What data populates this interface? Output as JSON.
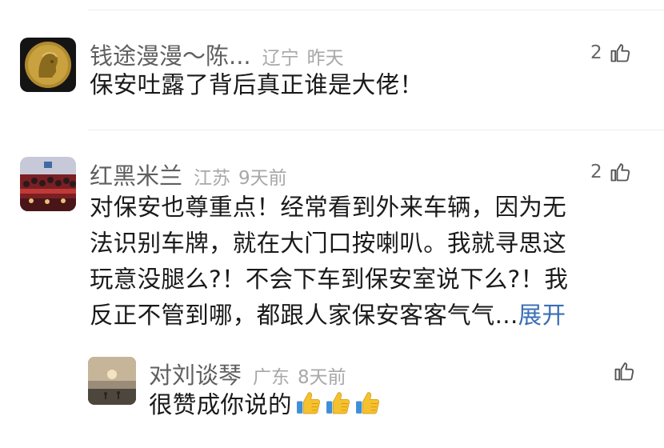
{
  "comments": [
    {
      "username": "钱途漫漫～陈...",
      "location": "辽宁",
      "time": "昨天",
      "likes": "2",
      "content": "保安吐露了背后真正谁是大佬！"
    },
    {
      "username": "红黑米兰",
      "location": "江苏",
      "time": "9天前",
      "likes": "2",
      "content_lines": [
        "对保安也尊重点！经常看到外来车辆，因为无",
        "法识别车牌，就在大门口按喇叭。我就寻思这",
        "玩意没腿么?！不会下车到保安室说下么?！我",
        "反正不管到哪，都跟人家保安客客气气..."
      ],
      "expand_label": "展开",
      "reply": {
        "username": "对刘谈琴",
        "location": "广东",
        "time": "8天前",
        "content": "很赞成你说的",
        "emoji": [
          "thumbs-up",
          "thumbs-up",
          "thumbs-up"
        ]
      }
    }
  ],
  "colors": {
    "username": "#5f5f5f",
    "meta": "#a8a8a8",
    "text": "#1a1a1a",
    "link": "#3a6fb5",
    "divider": "#ececec"
  }
}
